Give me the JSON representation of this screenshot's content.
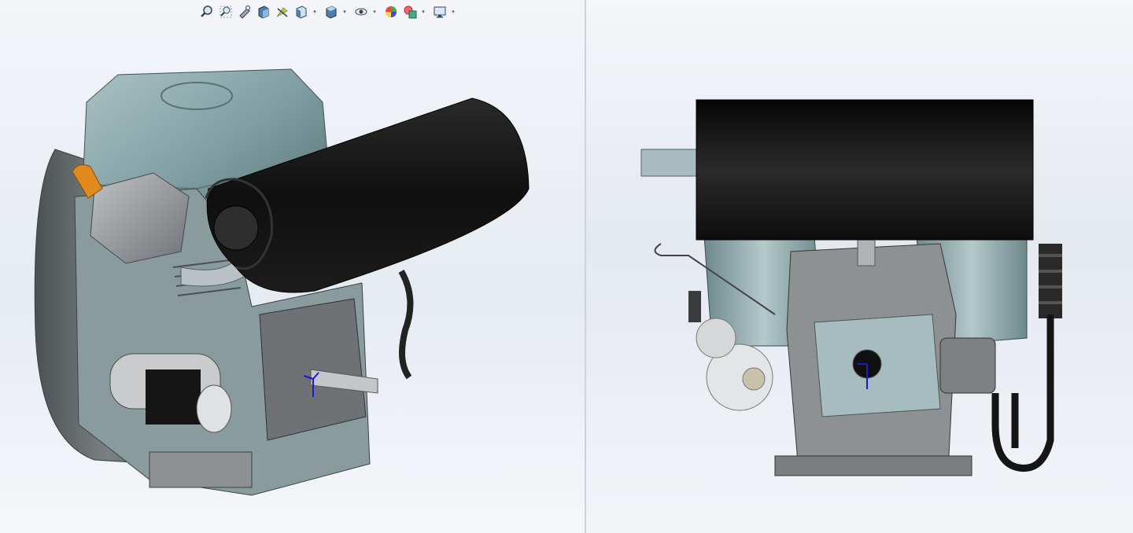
{
  "window": {
    "background": "#e9edf3"
  },
  "hud_toolbar": {
    "buttons": [
      {
        "name": "zoom-to-fit-icon",
        "has_dropdown": false
      },
      {
        "name": "zoom-to-area-icon",
        "has_dropdown": false
      },
      {
        "name": "previous-view-icon",
        "has_dropdown": false
      },
      {
        "name": "section-view-icon",
        "has_dropdown": false
      },
      {
        "name": "dynamic-annotation-icon",
        "has_dropdown": false
      },
      {
        "name": "view-orientation-icon",
        "has_dropdown": true
      },
      {
        "name": "display-style-icon",
        "has_dropdown": true
      },
      {
        "name": "hide-show-items-icon",
        "has_dropdown": true
      },
      {
        "name": "edit-appearance-icon",
        "has_dropdown": false
      },
      {
        "name": "apply-scene-icon",
        "has_dropdown": true
      },
      {
        "name": "view-settings-icon",
        "has_dropdown": true
      }
    ]
  },
  "viewports": [
    {
      "name": "isometric-viewport",
      "view": "isometric"
    },
    {
      "name": "front-viewport",
      "view": "front"
    }
  ],
  "colors": {
    "housing": "#7f9ea2",
    "muffler": "#111111",
    "metal": "#8c8f93",
    "orange": "#e08a1e",
    "triad_axis": "#1a1ad6"
  }
}
